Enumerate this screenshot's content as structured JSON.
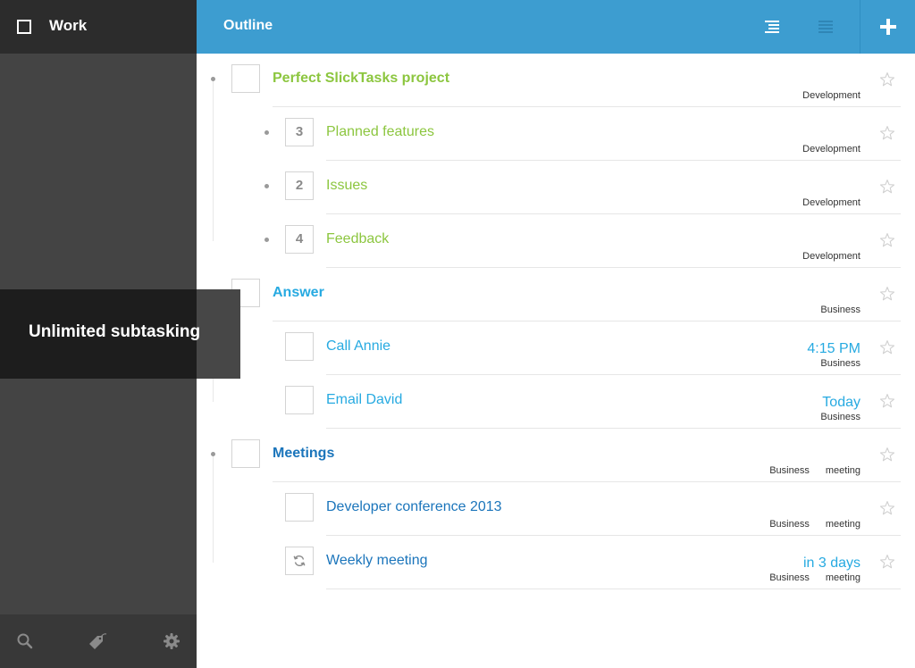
{
  "sidebar": {
    "title": "Work",
    "footer_icons": [
      "search-icon",
      "tag-icon",
      "gear-icon"
    ]
  },
  "header": {
    "title": "Outline",
    "icons": [
      "outline-view-icon",
      "list-view-icon",
      "add-icon"
    ]
  },
  "overlay": {
    "text": "Unlimited subtasking"
  },
  "colors": {
    "accent": "#3d9dd0",
    "green": "#8cc63f",
    "light_blue": "#27aae1",
    "dark_blue": "#1b75bb"
  },
  "tasks": [
    {
      "title": "Perfect SlickTasks project",
      "level": 0,
      "count": "",
      "due": "",
      "tags": [
        "Development"
      ],
      "color": "green",
      "bold": true,
      "bullet": true
    },
    {
      "title": "Planned features",
      "level": 1,
      "count": "3",
      "due": "",
      "tags": [
        "Development"
      ],
      "color": "green",
      "bold": false,
      "bullet": true
    },
    {
      "title": "Issues",
      "level": 1,
      "count": "2",
      "due": "",
      "tags": [
        "Development"
      ],
      "color": "green",
      "bold": false,
      "bullet": true
    },
    {
      "title": "Feedback",
      "level": 1,
      "count": "4",
      "due": "",
      "tags": [
        "Development"
      ],
      "color": "green",
      "bold": false,
      "bullet": true
    },
    {
      "title": "Answer",
      "level": 0,
      "count": "",
      "due": "",
      "tags": [
        "Business"
      ],
      "color": "lblue",
      "bold": true,
      "bullet": true
    },
    {
      "title": "Call Annie",
      "level": 1,
      "count": "",
      "due": "4:15 PM",
      "tags": [
        "Business"
      ],
      "color": "lblue",
      "bold": false,
      "bullet": false
    },
    {
      "title": "Email David",
      "level": 1,
      "count": "",
      "due": "Today",
      "tags": [
        "Business"
      ],
      "color": "lblue",
      "bold": false,
      "bullet": false
    },
    {
      "title": "Meetings",
      "level": 0,
      "count": "",
      "due": "",
      "tags": [
        "Business",
        "meeting"
      ],
      "color": "dblue",
      "bold": true,
      "bullet": true
    },
    {
      "title": "Developer conference 2013",
      "level": 1,
      "count": "",
      "due": "",
      "tags": [
        "Business",
        "meeting"
      ],
      "color": "dblue",
      "bold": false,
      "bullet": false
    },
    {
      "title": "Weekly meeting",
      "level": 1,
      "count": "",
      "due": "in 3 days",
      "tags": [
        "Business",
        "meeting"
      ],
      "color": "dblue",
      "bold": false,
      "bullet": false,
      "icon": "repeat-icon"
    }
  ]
}
